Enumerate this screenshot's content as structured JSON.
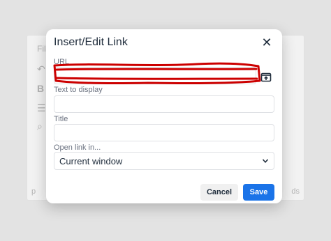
{
  "background_editor": {
    "menu_text": "File",
    "status_left": "p",
    "status_right": "ds"
  },
  "dialog": {
    "title": "Insert/Edit Link",
    "close_icon": "close-icon",
    "fields": {
      "url_label": "URL",
      "url_value": "",
      "text_label": "Text to display",
      "text_value": "",
      "title_label": "Title",
      "title_value": "",
      "open_label": "Open link in...",
      "open_value": "Current window"
    },
    "buttons": {
      "cancel": "Cancel",
      "save": "Save"
    }
  },
  "colors": {
    "accent": "#1a73e8",
    "annotation": "#cc0000",
    "text": "#222f3e"
  }
}
